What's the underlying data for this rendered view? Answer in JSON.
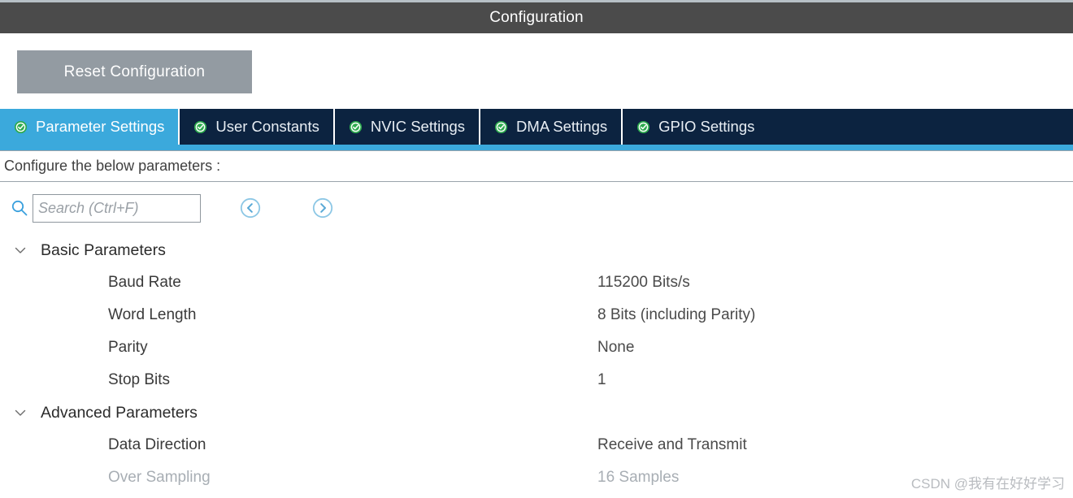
{
  "window": {
    "title": "Configuration",
    "titlebar_bg": "#4b4b4b"
  },
  "toolbar": {
    "reset_label": "Reset Configuration",
    "reset_bg": "#939ba2"
  },
  "tabs": {
    "active_color": "#3ba9dc",
    "inactive_color": "#0c2340",
    "check_color": "#2eab4f",
    "items": [
      {
        "label": "Parameter Settings",
        "icon": "check-circle-icon",
        "active": true
      },
      {
        "label": "User Constants",
        "icon": "check-circle-icon",
        "active": false
      },
      {
        "label": "NVIC Settings",
        "icon": "check-circle-icon",
        "active": false
      },
      {
        "label": "DMA Settings",
        "icon": "check-circle-icon",
        "active": false
      },
      {
        "label": "GPIO Settings",
        "icon": "check-circle-icon",
        "active": false
      }
    ]
  },
  "configure_bar": {
    "text": "Configure the below parameters :"
  },
  "search": {
    "placeholder": "Search (Ctrl+F)",
    "value": "",
    "icon": "search-icon",
    "prev_icon": "chevron-left-circle-icon",
    "next_icon": "chevron-right-circle-icon",
    "accent": "#5aa9d6"
  },
  "tree": {
    "groups": [
      {
        "label": "Basic Parameters",
        "expanded": true,
        "rows": [
          {
            "label": "Baud Rate",
            "value": "115200 Bits/s",
            "disabled": false
          },
          {
            "label": "Word Length",
            "value": "8 Bits (including Parity)",
            "disabled": false
          },
          {
            "label": "Parity",
            "value": "None",
            "disabled": false
          },
          {
            "label": "Stop Bits",
            "value": "1",
            "disabled": false
          }
        ]
      },
      {
        "label": "Advanced Parameters",
        "expanded": true,
        "rows": [
          {
            "label": "Data Direction",
            "value": "Receive and Transmit",
            "disabled": false
          },
          {
            "label": "Over Sampling",
            "value": "16 Samples",
            "disabled": true
          }
        ]
      }
    ]
  },
  "watermark": {
    "text": "CSDN @我有在好好学习"
  }
}
